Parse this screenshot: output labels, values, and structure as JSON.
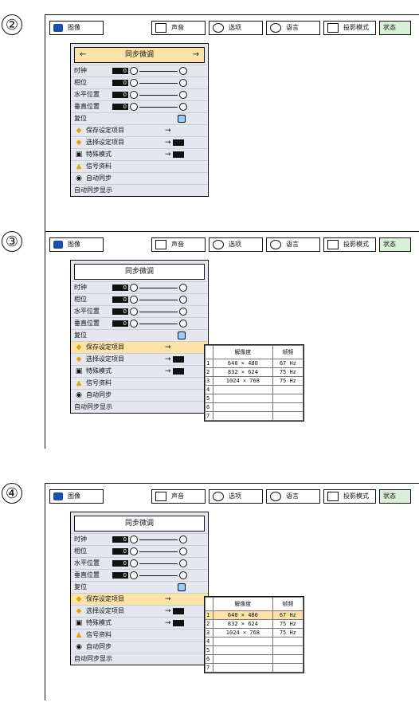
{
  "steps": [
    "②",
    "③",
    "④"
  ],
  "tabs": {
    "image": "图像",
    "sound": "声音",
    "options": "选项",
    "language": "语言",
    "projection": "投影模式",
    "status": "状态"
  },
  "menu": {
    "title": "同步微调",
    "rows": {
      "clock": "时钟",
      "phase": "相位",
      "hpos": "水平位置",
      "vpos": "垂直位置",
      "reset": "复位",
      "save": "保存设定项目",
      "select": "选择设定项目",
      "special": "特殊模式",
      "signal": "信号资料",
      "autosync": "自动同步",
      "autosync_disp": "自动同步显示"
    },
    "value": "0"
  },
  "table": {
    "headers": [
      "解像度",
      "帧频"
    ],
    "rows": [
      {
        "idx": "1",
        "res": "640 × 480",
        "freq": "67 Hz"
      },
      {
        "idx": "2",
        "res": "832 × 624",
        "freq": "75 Hz"
      },
      {
        "idx": "3",
        "res": "1024 × 768",
        "freq": "75 Hz"
      },
      {
        "idx": "4",
        "res": "",
        "freq": ""
      },
      {
        "idx": "5",
        "res": "",
        "freq": ""
      },
      {
        "idx": "6",
        "res": "",
        "freq": ""
      },
      {
        "idx": "7",
        "res": "",
        "freq": ""
      }
    ]
  }
}
